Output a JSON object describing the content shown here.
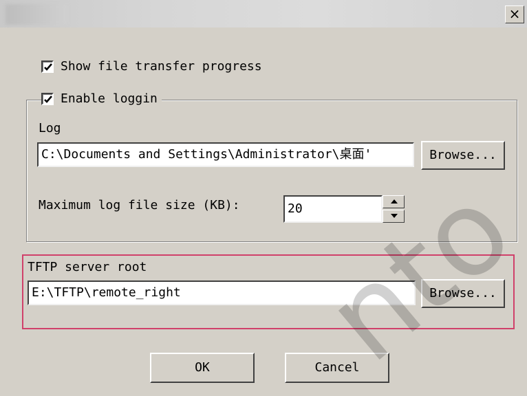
{
  "window": {
    "title": "",
    "close_label": "×"
  },
  "options": {
    "show_progress_label": "Show file transfer progress",
    "show_progress_checked": true,
    "enable_logging_label": "Enable loggin",
    "enable_logging_checked": true
  },
  "log": {
    "label": "Log",
    "path_value": "C:\\Documents and Settings\\Administrator\\桌面'",
    "browse_label": "Browse...",
    "max_size_label": "Maximum log file size (KB):",
    "max_size_value": "20"
  },
  "tftp": {
    "label": "TFTP server root",
    "path_value": "E:\\TFTP\\remote_right",
    "browse_label": "Browse..."
  },
  "footer": {
    "ok_label": "OK",
    "cancel_label": "Cancel"
  },
  "watermark": {
    "text": "nto"
  },
  "colors": {
    "highlight_border": "#d0406a",
    "dialog_bg": "#d4d0c8"
  }
}
